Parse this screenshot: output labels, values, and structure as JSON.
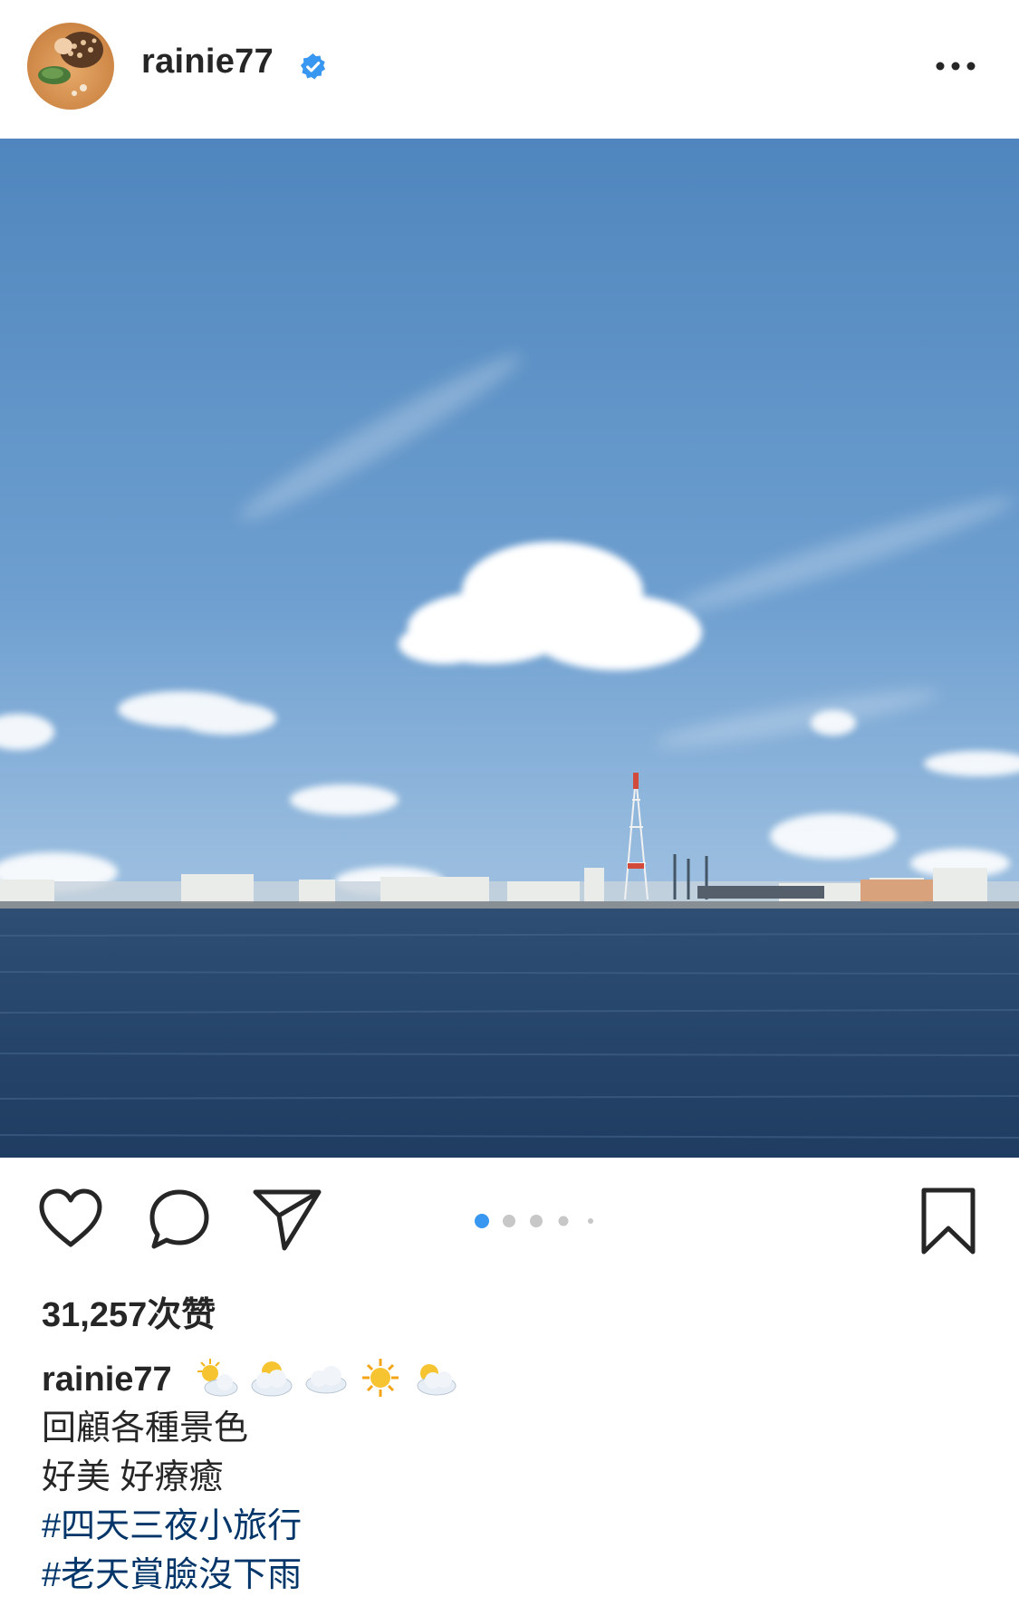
{
  "header": {
    "username": "rainie77",
    "verified": true,
    "avatar_icon": "avatar-icon",
    "more_icon": "more-options-icon"
  },
  "post": {
    "image_description_icon": "photo",
    "carousel": {
      "count": 5,
      "active_index": 0
    }
  },
  "actions": {
    "like_icon": "heart-icon",
    "comment_icon": "comment-icon",
    "share_icon": "share-icon",
    "save_icon": "bookmark-icon"
  },
  "likes_text": "31,257次赞",
  "caption": {
    "username": "rainie77",
    "emojis": [
      "sun-behind-small-cloud",
      "sun-behind-cloud",
      "cloud",
      "sun",
      "sun-behind-cloud"
    ],
    "lines": [
      "回顧各種景色",
      "好美 好療癒"
    ],
    "hashtags": [
      "#四天三夜小旅行",
      "#老天賞臉沒下雨"
    ]
  },
  "colors": {
    "verified": "#3897f0",
    "hashtag": "#003569",
    "active_dot": "#3897f0",
    "inactive_dot": "#c7c7c7"
  }
}
